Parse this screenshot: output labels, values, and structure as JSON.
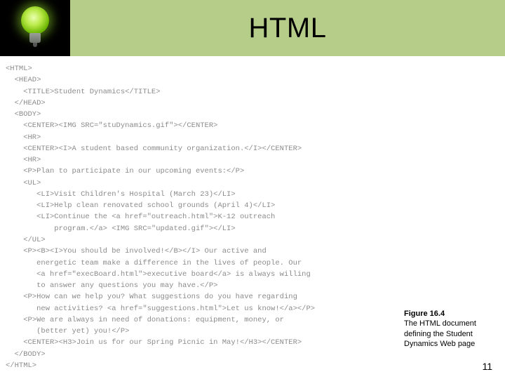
{
  "header": {
    "title": "HTML",
    "icon_name": "lightbulb-icon"
  },
  "code": {
    "l01": "<HTML>",
    "l02": "  <HEAD>",
    "l03": "    <TITLE>Student Dynamics</TITLE>",
    "l04": "  </HEAD>",
    "l05": "  <BODY>",
    "l06": "    <CENTER><IMG SRC=\"stuDynamics.gif\"></CENTER>",
    "l07": "    <HR>",
    "l08": "    <CENTER><I>A student based community organization.</I></CENTER>",
    "l09": "    <HR>",
    "l10": "    <P>Plan to participate in our upcoming events:</P>",
    "l11": "    <UL>",
    "l12": "       <LI>Visit Children's Hospital (March 23)</LI>",
    "l13": "       <LI>Help clean renovated school grounds (April 4)</LI>",
    "l14": "       <LI>Continue the <a href=\"outreach.html\">K-12 outreach",
    "l15": "           program.</a> <IMG SRC=\"updated.gif\"></LI>",
    "l16": "    </UL>",
    "l17": "    <P><B><I>You should be involved!</B></I> Our active and",
    "l18": "       energetic team make a difference in the lives of people. Our",
    "l19": "       <a href=\"execBoard.html\">executive board</a> is always willing",
    "l20": "       to answer any questions you may have.</P>",
    "l21": "    <P>How can we help you? What suggestions do you have regarding",
    "l22": "       new activities? <a href=\"suggestions.html\">Let us know!</a></P>",
    "l23": "    <P>We are always in need of donations: equipment, money, or",
    "l24": "       (better yet) you!</P>",
    "l25": "    <CENTER><H3>Join us for our Spring Picnic in May!</H3></CENTER>",
    "l26": "  </BODY>",
    "l27": "</HTML>"
  },
  "caption": {
    "fig": "Figure 16.4",
    "text": "The HTML document defining the Student Dynamics Web page"
  },
  "page_number": "11"
}
